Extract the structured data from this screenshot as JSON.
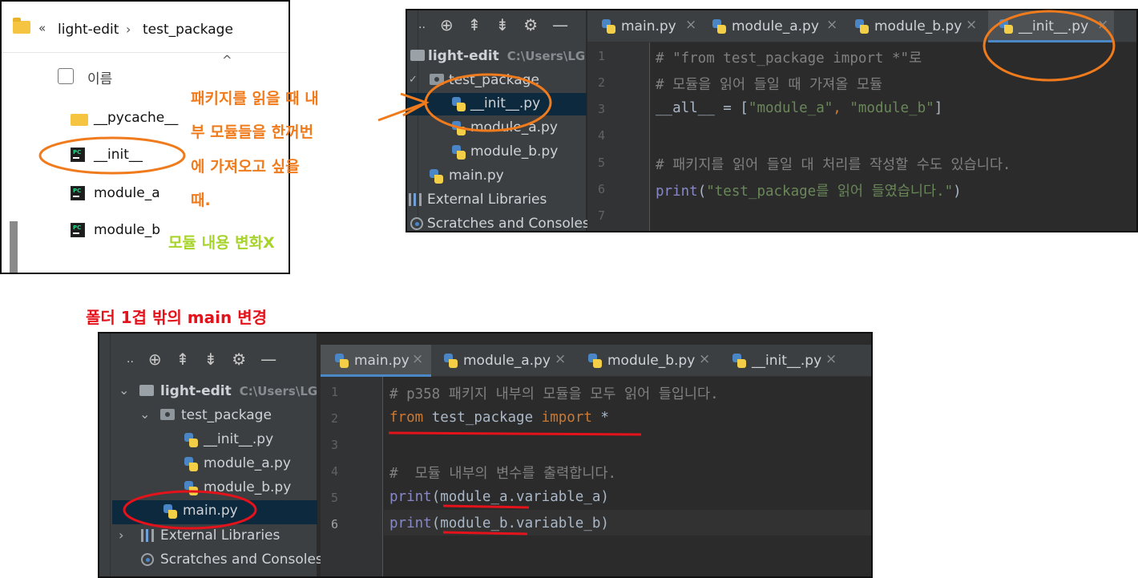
{
  "explorer": {
    "breadcrumb_chevron": "«",
    "breadcrumb": [
      "light-edit",
      "test_package"
    ],
    "breadcrumb_sep": "›",
    "sort_caret": "^",
    "column_name": "이름",
    "items": [
      {
        "name": "__pycache__",
        "icon": "folder-icon"
      },
      {
        "name": "__init__",
        "icon": "pycharm-file-icon"
      },
      {
        "name": "module_a",
        "icon": "pycharm-file-icon"
      },
      {
        "name": "module_b",
        "icon": "pycharm-file-icon"
      }
    ]
  },
  "annotations": {
    "orange_lines": [
      "패키지를 읽을 때 내",
      "부 모듈들을 한꺼번",
      "에 가져오고 싶을",
      "때."
    ],
    "green_text": "모듈 내용 변화X",
    "red_text": "폴더 1겹 밖의 main 변경",
    "colors": {
      "orange": "#f07b1d",
      "green": "#a7d42a",
      "red": "#e3121b"
    }
  },
  "ide_top": {
    "tree": [
      {
        "label": "light-edit",
        "path": "C:\\Users\\LG",
        "icon": "folder-icon"
      },
      {
        "label": "test_package",
        "icon": "package-icon"
      },
      {
        "label": "__init__.py",
        "icon": "python-file-icon",
        "selected": true
      },
      {
        "label": "module_a.py",
        "icon": "python-file-icon"
      },
      {
        "label": "module_b.py",
        "icon": "python-file-icon"
      },
      {
        "label": "main.py",
        "icon": "python-file-icon"
      },
      {
        "label": "External Libraries",
        "icon": "library-icon"
      },
      {
        "label": "Scratches and Consoles",
        "icon": "scratch-icon"
      }
    ],
    "tabs": [
      "main.py",
      "module_a.py",
      "module_b.py",
      "__init__.py"
    ],
    "active_tab": "__init__.py",
    "tool_glyphs": {
      "dots": "..",
      "target": "⊕",
      "collapse": "⇞",
      "expand": "⇟",
      "gear": "⚙",
      "minimize": "—",
      "close": "×",
      "arrow": "✓"
    },
    "line_numbers": [
      "1",
      "2",
      "3",
      "4",
      "5",
      "6",
      "7"
    ],
    "code": {
      "l1": "# \"from test_package import *\"로",
      "l2": "# 모듈을 읽어 들일 때 가져올 모듈",
      "l3_a": "__all__ = [",
      "l3_s1": "\"module_a\"",
      "l3_comma": ", ",
      "l3_s2": "\"module_b\"",
      "l3_b": "]",
      "l5": "# 패키지를 읽어 들일 대 처리를 작성할 수도 있습니다.",
      "l6_fn": "print",
      "l6_open": "(",
      "l6_str": "\"test_package를 읽어 들였습니다.\"",
      "l6_close": ")"
    }
  },
  "ide_bot": {
    "tree": [
      {
        "label": "light-edit",
        "path": "C:\\Users\\LG",
        "icon": "folder-icon"
      },
      {
        "label": "test_package",
        "icon": "package-icon"
      },
      {
        "label": "__init__.py",
        "icon": "python-file-icon"
      },
      {
        "label": "module_a.py",
        "icon": "python-file-icon"
      },
      {
        "label": "module_b.py",
        "icon": "python-file-icon"
      },
      {
        "label": "main.py",
        "icon": "python-file-icon",
        "selected": true
      },
      {
        "label": "External Libraries",
        "icon": "library-icon"
      },
      {
        "label": "Scratches and Consoles",
        "icon": "scratch-icon"
      }
    ],
    "tabs": [
      "main.py",
      "module_a.py",
      "module_b.py",
      "__init__.py"
    ],
    "active_tab": "main.py",
    "tool_glyphs": {
      "dots": "..",
      "target": "⊕",
      "collapse": "⇞",
      "expand": "⇟",
      "gear": "⚙",
      "minimize": "—",
      "close": "×",
      "expanded": "⌄",
      "collapsed": "›"
    },
    "line_numbers": [
      "1",
      "2",
      "3",
      "4",
      "5",
      "6"
    ],
    "code": {
      "l1": "# p358 패키지 내부의 모듈을 모두 읽어 들입니다.",
      "l2_kw1": "from",
      "l2_mid": " test_package ",
      "l2_kw2": "import",
      "l2_star": " *",
      "l4": "#  모듈 내부의 변수를 출력합니다.",
      "l5_fn": "print",
      "l5_arg": "(module_a.variable_a)",
      "l6_fn": "print",
      "l6_arg": "(module_b.variable_b)"
    }
  }
}
